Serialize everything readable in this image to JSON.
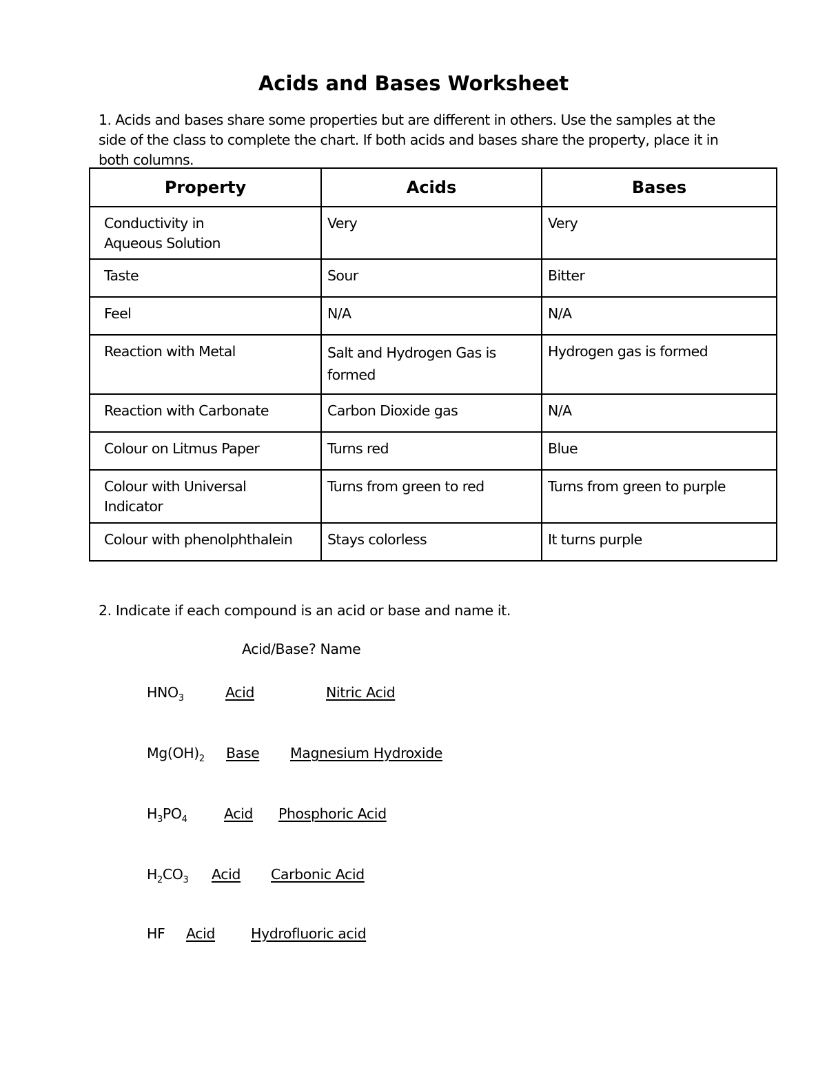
{
  "title": "Acids and Bases Worksheet",
  "question1": {
    "prompt": "1. Acids and bases share some properties but are different in others. Use the samples at the side of the class to complete the chart. If both acids and bases share the property, place it in both columns.",
    "table": {
      "headers": [
        "Property",
        "Acids",
        "Bases"
      ],
      "rows": [
        {
          "property": "Conductivity in Aqueous Solution",
          "acids": "Very",
          "bases": "Very"
        },
        {
          "property": "Taste",
          "acids": "Sour",
          "bases": "Bitter"
        },
        {
          "property": "Feel",
          "acids": "N/A",
          "bases": "N/A"
        },
        {
          "property": "Reaction with Metal",
          "acids": "Salt and Hydrogen Gas is formed",
          "bases": "Hydrogen gas is formed"
        },
        {
          "property": "Reaction with Carbonate",
          "acids": "Carbon Dioxide gas",
          "bases": "N/A"
        },
        {
          "property": "Colour on Litmus Paper",
          "acids": "Turns red",
          "bases": "Blue"
        },
        {
          "property": "Colour with Universal Indicator",
          "acids": "Turns from green to red",
          "bases": "Turns from green to purple"
        },
        {
          "property": "Colour with phenolphthalein",
          "acids": "Stays colorless",
          "bases": "It turns purple"
        }
      ]
    }
  },
  "question2": {
    "prompt": "2. Indicate if each compound is an acid or base and name it.",
    "column_header": "Acid/Base? Name",
    "compounds": [
      {
        "formula_parts": [
          "HNO",
          "3"
        ],
        "type": "Acid",
        "name": "Nitric Acid"
      },
      {
        "formula_parts": [
          "Mg(OH)",
          "2"
        ],
        "type": "Base",
        "name": "Magnesium Hydroxide"
      },
      {
        "formula_parts": [
          "H",
          "3",
          "PO",
          "4"
        ],
        "type": "Acid",
        "name": "Phosphoric Acid"
      },
      {
        "formula_parts": [
          "H",
          "2",
          "CO",
          "3"
        ],
        "type": "Acid",
        "name": "Carbonic Acid"
      },
      {
        "formula_parts": [
          "HF"
        ],
        "type": "Acid",
        "name": "Hydrofluoric acid"
      }
    ]
  }
}
